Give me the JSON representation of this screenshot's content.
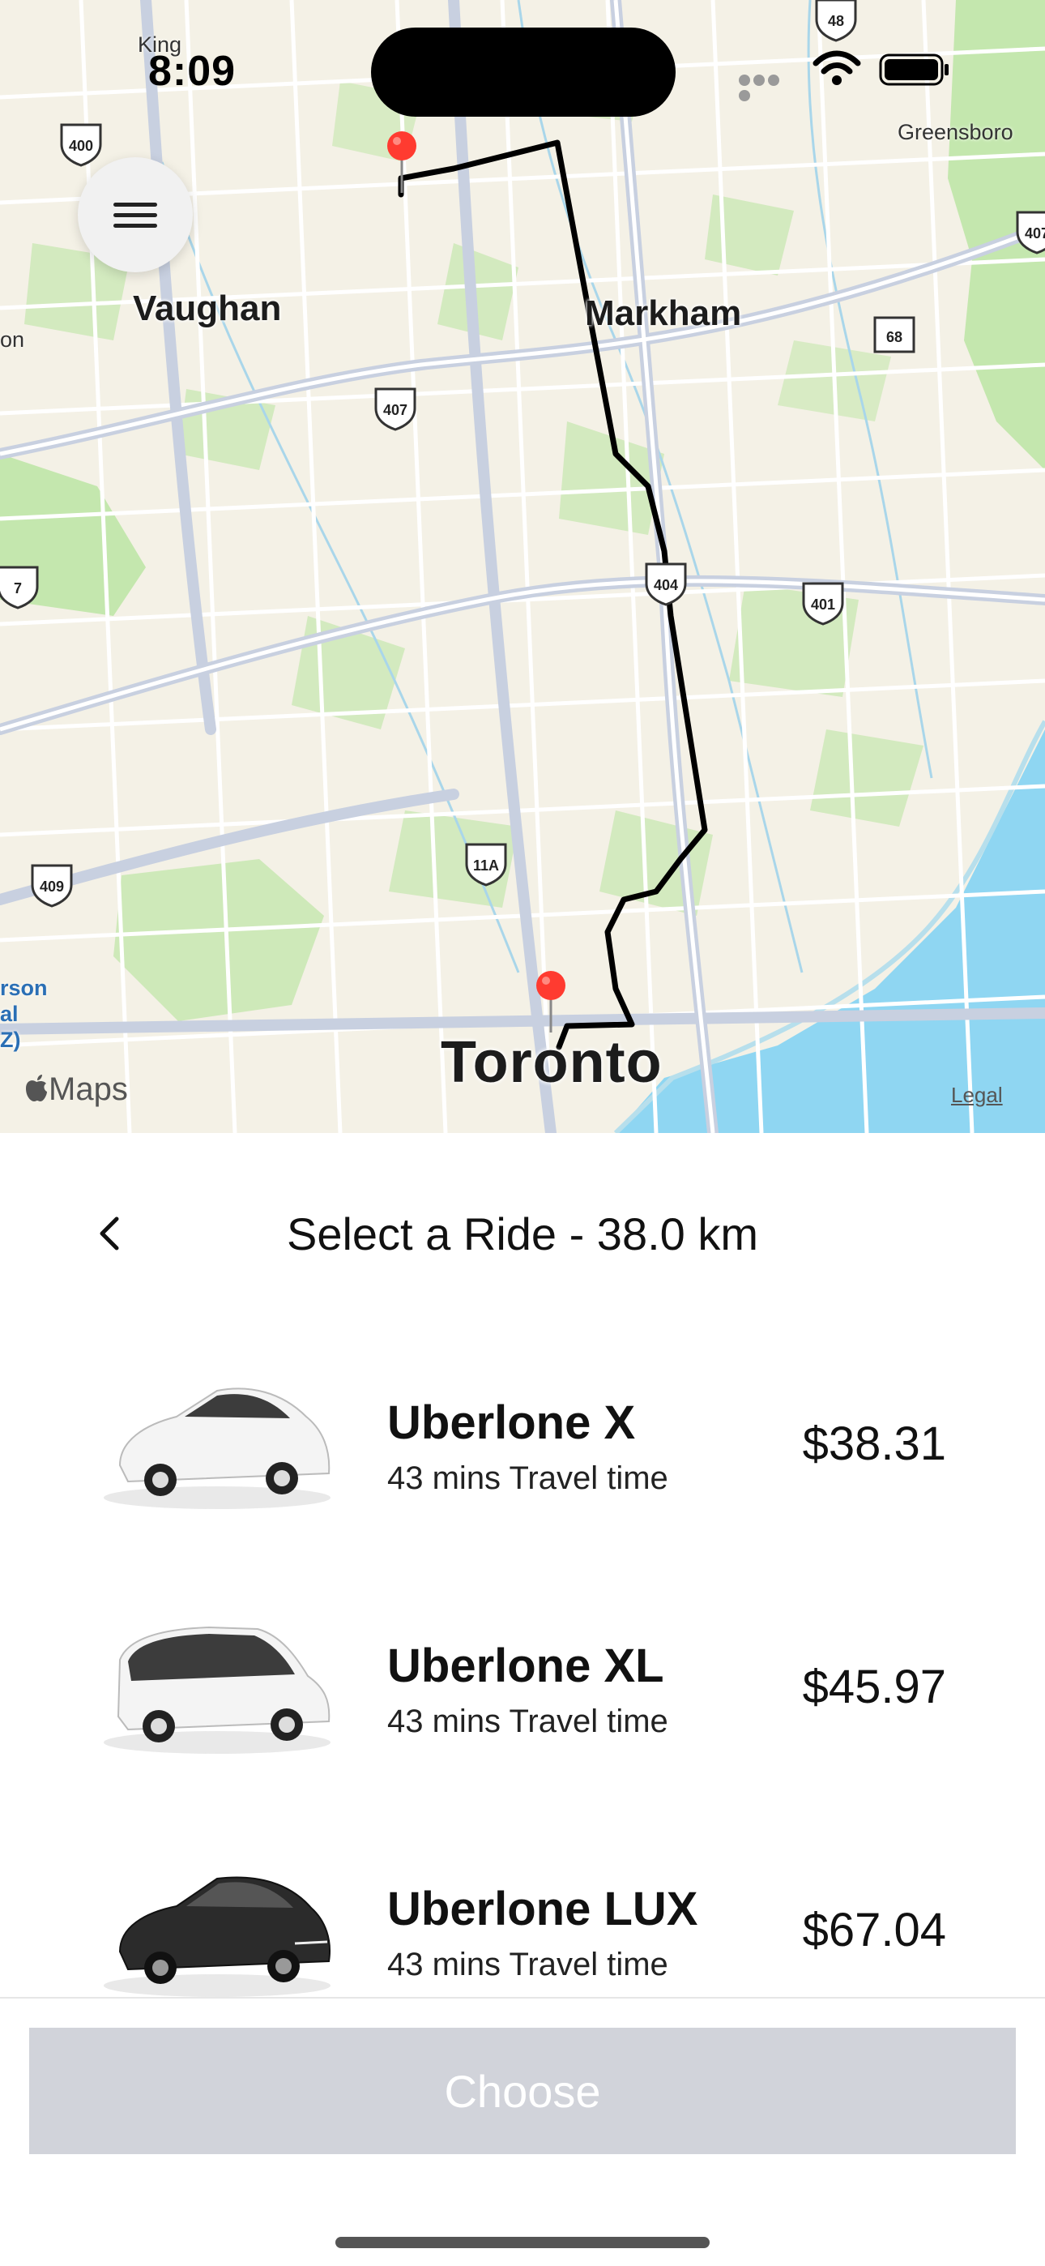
{
  "status": {
    "time": "8:09"
  },
  "map": {
    "labels": {
      "king": "King",
      "greensboro": "Greensboro",
      "vaughan": "Vaughan",
      "markham": "Markham",
      "toronto": "Toronto",
      "edge_on": "on",
      "edge_rson": "rson",
      "edge_al": "al",
      "edge_z": "Z)"
    },
    "shields": {
      "s48": "48",
      "s400": "400",
      "s407a": "407",
      "s407b": "407",
      "s68": "68",
      "s7": "7",
      "s404": "404",
      "s401": "401",
      "s409": "409",
      "s11a": "11A"
    },
    "attribution": "Maps",
    "legal": "Legal",
    "colors": {
      "route": "#000000",
      "pin": "#ff3b30",
      "water": "#8fd6f2",
      "park": "#b9e3a0",
      "land": "#f4f1e6"
    }
  },
  "panel": {
    "title": "Select a Ride - 38.0 km",
    "rides": [
      {
        "name": "Uberlone X",
        "time": "43 mins Travel time",
        "price": "$38.31",
        "car_color": "white"
      },
      {
        "name": "Uberlone XL",
        "time": "43 mins Travel time",
        "price": "$45.97",
        "car_color": "white"
      },
      {
        "name": "Uberlone LUX",
        "time": "43 mins Travel time",
        "price": "$67.04",
        "car_color": "black"
      }
    ],
    "choose_label": "Choose"
  },
  "icons": {
    "menu": "hamburger-menu-icon",
    "back": "chevron-left-icon",
    "wifi": "wifi-icon",
    "battery": "battery-icon",
    "pin": "map-pin-icon",
    "apple": "apple-logo-icon"
  }
}
